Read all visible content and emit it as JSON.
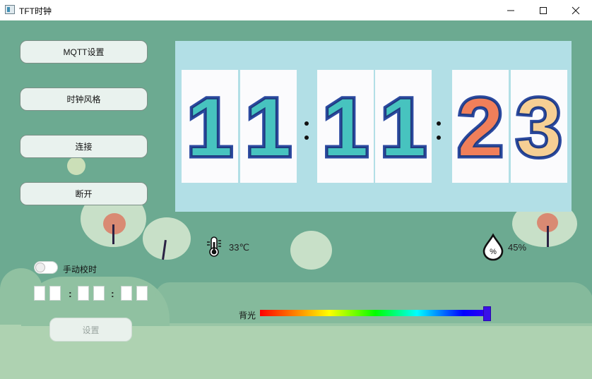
{
  "window": {
    "title": "TFT时钟"
  },
  "buttons": {
    "mqtt": "MQTT设置",
    "clock_style": "时钟风格",
    "connect": "连接",
    "disconnect": "断开",
    "set": "设置"
  },
  "clock": {
    "digits": [
      "1",
      "1",
      "1",
      "1",
      "2",
      "3"
    ],
    "digit_colors": [
      "#47c3bf",
      "#47c3bf",
      "#47c3bf",
      "#47c3bf",
      "#f07f5a",
      "#f6cf94"
    ]
  },
  "weather": {
    "temperature": "33℃",
    "humidity": "45%",
    "humidity_icon_text": "%"
  },
  "manual_time": {
    "toggle_label": "手动校时",
    "toggle_on": false
  },
  "backlight": {
    "label": "背光",
    "level_percent": 100
  },
  "icons": {
    "app": "app-icon",
    "minimize": "minimize-icon",
    "maximize": "maximize-icon",
    "close": "close-icon",
    "temperature": "thermometer-icon",
    "humidity": "water-drop-icon"
  },
  "colors": {
    "background": "#6caa91",
    "clock_panel": "#b2dfe6",
    "ground": "#aed2b1",
    "slider_handle": "#3a10e8"
  }
}
